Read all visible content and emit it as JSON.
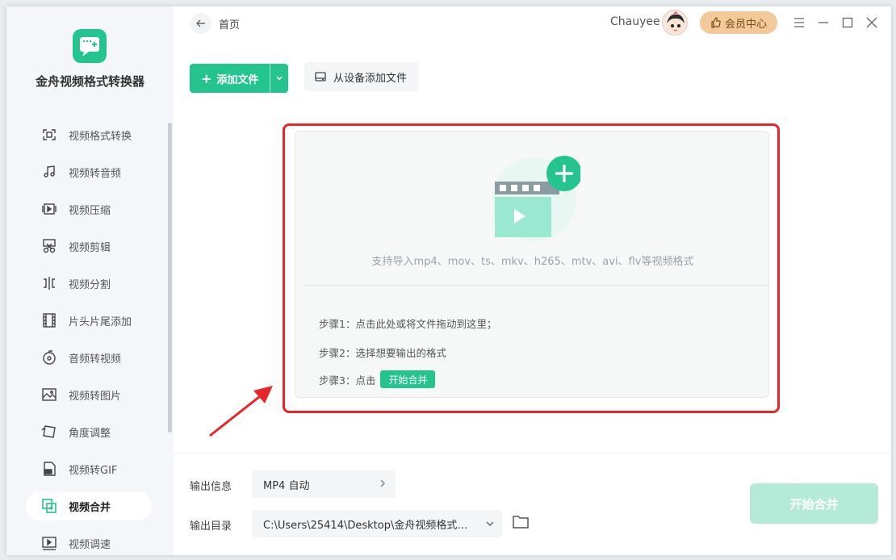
{
  "app": {
    "name": "金舟视频格式转换器"
  },
  "header": {
    "breadcrumb": "首页",
    "username": "Chauyee",
    "vip_label": "会员中心"
  },
  "sidebar": {
    "items": [
      {
        "label": "视频格式转换",
        "icon": "format-convert-icon"
      },
      {
        "label": "视频转音频",
        "icon": "music-note-icon"
      },
      {
        "label": "视频压缩",
        "icon": "compress-icon"
      },
      {
        "label": "视频剪辑",
        "icon": "scissors-icon"
      },
      {
        "label": "视频分割",
        "icon": "split-icon"
      },
      {
        "label": "片头片尾添加",
        "icon": "film-strip-icon"
      },
      {
        "label": "音频转视频",
        "icon": "disc-icon"
      },
      {
        "label": "视频转图片",
        "icon": "image-icon"
      },
      {
        "label": "角度调整",
        "icon": "rotate-icon"
      },
      {
        "label": "视频转GIF",
        "icon": "gif-file-icon"
      },
      {
        "label": "视频合并",
        "icon": "merge-icon",
        "active": true
      },
      {
        "label": "视频调速",
        "icon": "speed-icon"
      }
    ]
  },
  "toolbar": {
    "add_file_label": "添加文件",
    "add_device_label": "从设备添加文件"
  },
  "dropzone": {
    "formats_text": "支持导入mp4、mov、ts、mkv、h265、mtv、avi、flv等视频格式",
    "step1": "步骤1：点击此处或将文件拖动到这里；",
    "step2": "步骤2：选择想要输出的格式",
    "step3": "步骤3：点击",
    "step3_button": "开始合并"
  },
  "output": {
    "info_label": "输出信息",
    "info_value": "MP4 自动",
    "dir_label": "输出目录",
    "dir_value": "C:\\Users\\25414\\Desktop\\金舟视频格式转换器"
  },
  "start_button": "开始合并",
  "colors": {
    "accent": "#23c48e",
    "highlight": "#e8262a",
    "vip": "#f3c999"
  }
}
